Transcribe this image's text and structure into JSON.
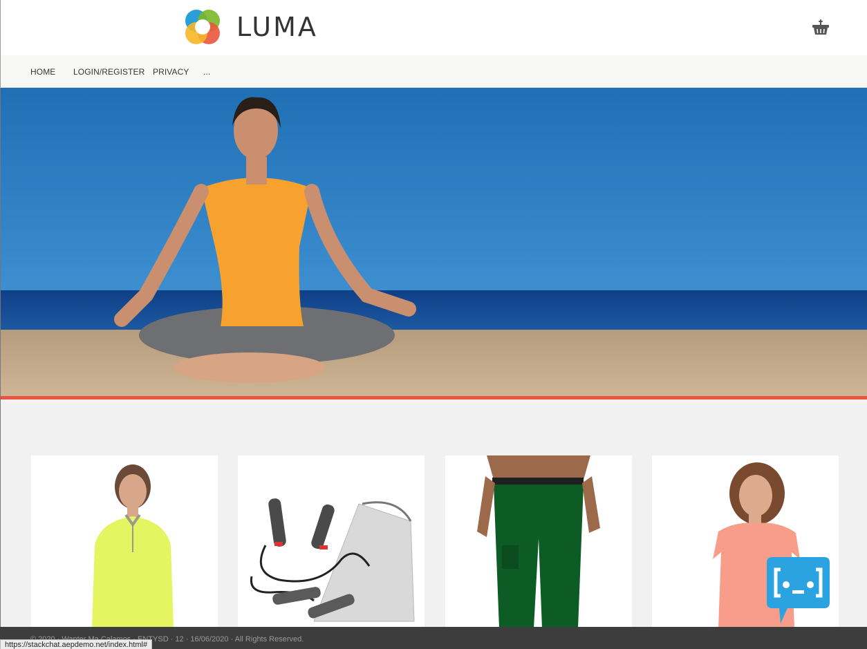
{
  "header": {
    "logo_text": "LUMA",
    "logo_icon": "luma-logo-icon",
    "cart_icon": "basket-icon"
  },
  "nav": {
    "items": [
      {
        "label": "HOME"
      },
      {
        "label": "LOGIN/REGISTER"
      },
      {
        "label": "PRIVACY"
      },
      {
        "label": "..."
      }
    ]
  },
  "hero": {
    "image": "woman-meditating-on-beach",
    "accent_color": "#e9563f"
  },
  "products": [
    {
      "image": "woman-yellow-half-zip-pullover"
    },
    {
      "image": "jump-rope-with-mesh-bag"
    },
    {
      "image": "man-green-cargo-pants"
    },
    {
      "image": "woman-coral-tshirt"
    }
  ],
  "footer": {
    "copyright": "© 2020 · Wanter Ma Calamos · ENTYSD · 12 · 16/06/2020 · All Rights Reserved.",
    "status_url": "https://stackchat.aepdemo.net/index.html#"
  },
  "chatbot": {
    "icon": "chatbot-icon",
    "color": "#2aa3e0"
  }
}
